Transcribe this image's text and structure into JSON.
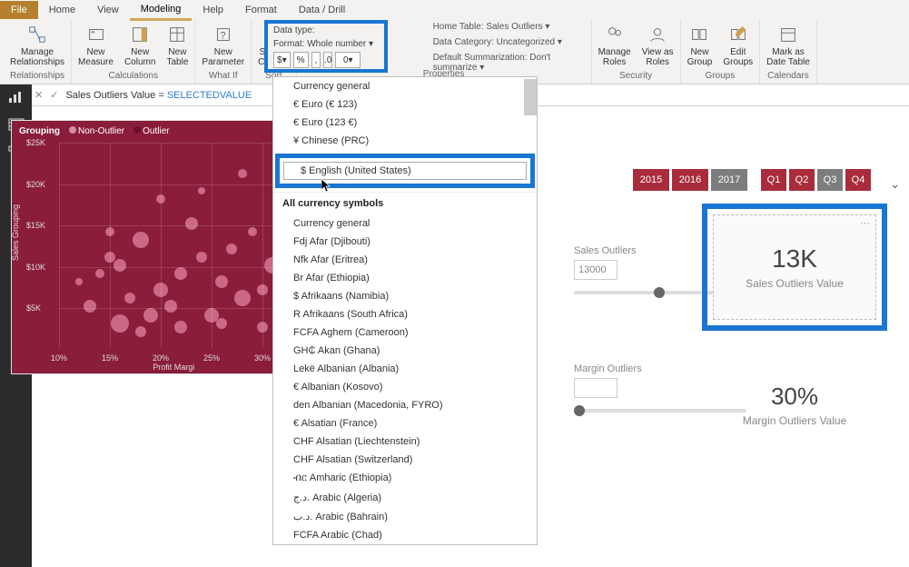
{
  "tabs": {
    "file": "File",
    "home": "Home",
    "view": "View",
    "modeling": "Modeling",
    "help": "Help",
    "format": "Format",
    "data_drill": "Data / Drill"
  },
  "ribbon": {
    "relationships": {
      "manage": "Manage\nRelationships",
      "label": "Relationships"
    },
    "calculations": {
      "new_measure": "New\nMeasure",
      "new_column": "New\nColumn",
      "new_table": "New\nTable",
      "label": "Calculations"
    },
    "whatif": {
      "new_parameter": "New\nParameter",
      "label": "What If"
    },
    "sort": {
      "sort_by": "Sort by\nColumn",
      "label": "Sort"
    },
    "properties": {
      "data_type": "Data type:",
      "format": "Format: Whole number",
      "home_table": "Home Table: Sales Outliers",
      "data_category": "Data Category: Uncategorized",
      "default_sum": "Default Summarization: Don't summarize",
      "label": "Properties",
      "dollar": "$",
      "pct": "%",
      "comma": ",",
      "dec": "0"
    },
    "security": {
      "manage_roles": "Manage\nRoles",
      "view_as": "View as\nRoles",
      "label": "Security"
    },
    "groups": {
      "new_group": "New\nGroup",
      "edit_groups": "Edit\nGroups",
      "label": "Groups"
    },
    "calendars": {
      "mark_as": "Mark as\nDate Table",
      "label": "Calendars"
    }
  },
  "formula": {
    "text": "Sales Outliers Value = ",
    "fn": "SELECTEDVALUE"
  },
  "dropdown": {
    "recent": [
      "Currency general",
      "€ Euro (€ 123)",
      "€ Euro (123 €)",
      "¥ Chinese (PRC)"
    ],
    "highlighted": "$ English (United States)",
    "section": "All currency symbols",
    "all": [
      "Currency general",
      "Fdj Afar (Djibouti)",
      "Nfk Afar (Eritrea)",
      "Br Afar (Ethiopia)",
      "$ Afrikaans (Namibia)",
      "R Afrikaans (South Africa)",
      "FCFA Aghem (Cameroon)",
      "GH₵ Akan (Ghana)",
      "Lekë Albanian (Albania)",
      "€ Albanian (Kosovo)",
      "den Albanian (Macedonia, FYRO)",
      "€ Alsatian (France)",
      "CHF Alsatian (Liechtenstein)",
      "CHF Alsatian (Switzerland)",
      "ብር Amharic (Ethiopia)",
      "د.ج. Arabic (Algeria)",
      "د.ب. Arabic (Bahrain)",
      "FCFA Arabic (Chad)"
    ]
  },
  "years": [
    "2015",
    "2016",
    "2017"
  ],
  "quarters": [
    "Q1",
    "Q2",
    "Q3",
    "Q4"
  ],
  "slicers": {
    "sales": {
      "label": "Sales Outliers",
      "value": "13000"
    },
    "margin": {
      "label": "Margin Outliers"
    }
  },
  "cards": {
    "sales": {
      "value": "13K",
      "label": "Sales Outliers Value"
    },
    "margin": {
      "value": "30%",
      "label": "Margin Outliers Value"
    }
  },
  "chart_data": {
    "type": "scatter",
    "legend_title": "Grouping",
    "series_names": [
      "Non-Outlier",
      "Outlier"
    ],
    "ylabel": "Sales Grouping",
    "xlabel": "Profit Margi",
    "ylim": [
      0,
      25000
    ],
    "xlim": [
      10,
      35
    ],
    "yticks": [
      "$25K",
      "$20K",
      "$15K",
      "$10K",
      "$5K"
    ],
    "xticks": [
      "10%",
      "15%",
      "20%",
      "25%",
      "30%"
    ],
    "points": [
      {
        "x": 15,
        "y": 11,
        "r": 6
      },
      {
        "x": 16,
        "y": 10,
        "r": 7
      },
      {
        "x": 14,
        "y": 9,
        "r": 5
      },
      {
        "x": 18,
        "y": 13,
        "r": 9
      },
      {
        "x": 20,
        "y": 7,
        "r": 8
      },
      {
        "x": 22,
        "y": 9,
        "r": 7
      },
      {
        "x": 24,
        "y": 11,
        "r": 6
      },
      {
        "x": 26,
        "y": 8,
        "r": 7
      },
      {
        "x": 28,
        "y": 6,
        "r": 9
      },
      {
        "x": 30,
        "y": 7,
        "r": 6
      },
      {
        "x": 32,
        "y": 5,
        "r": 6
      },
      {
        "x": 19,
        "y": 4,
        "r": 8
      },
      {
        "x": 17,
        "y": 6,
        "r": 6
      },
      {
        "x": 21,
        "y": 5,
        "r": 7
      },
      {
        "x": 25,
        "y": 4,
        "r": 8
      },
      {
        "x": 27,
        "y": 12,
        "r": 6
      },
      {
        "x": 29,
        "y": 14,
        "r": 5
      },
      {
        "x": 31,
        "y": 10,
        "r": 9
      },
      {
        "x": 33,
        "y": 9,
        "r": 6
      },
      {
        "x": 23,
        "y": 15,
        "r": 7
      },
      {
        "x": 12,
        "y": 8,
        "r": 4
      },
      {
        "x": 13,
        "y": 5,
        "r": 7
      },
      {
        "x": 34,
        "y": 6,
        "r": 6
      },
      {
        "x": 16,
        "y": 3,
        "r": 10
      },
      {
        "x": 18,
        "y": 2,
        "r": 6
      },
      {
        "x": 22,
        "y": 2.5,
        "r": 7
      },
      {
        "x": 26,
        "y": 3,
        "r": 6
      },
      {
        "x": 30,
        "y": 2.5,
        "r": 6
      },
      {
        "x": 20,
        "y": 18,
        "r": 5
      },
      {
        "x": 15,
        "y": 14,
        "r": 5
      },
      {
        "x": 24,
        "y": 19,
        "r": 4
      },
      {
        "x": 28,
        "y": 21,
        "r": 5
      }
    ]
  }
}
